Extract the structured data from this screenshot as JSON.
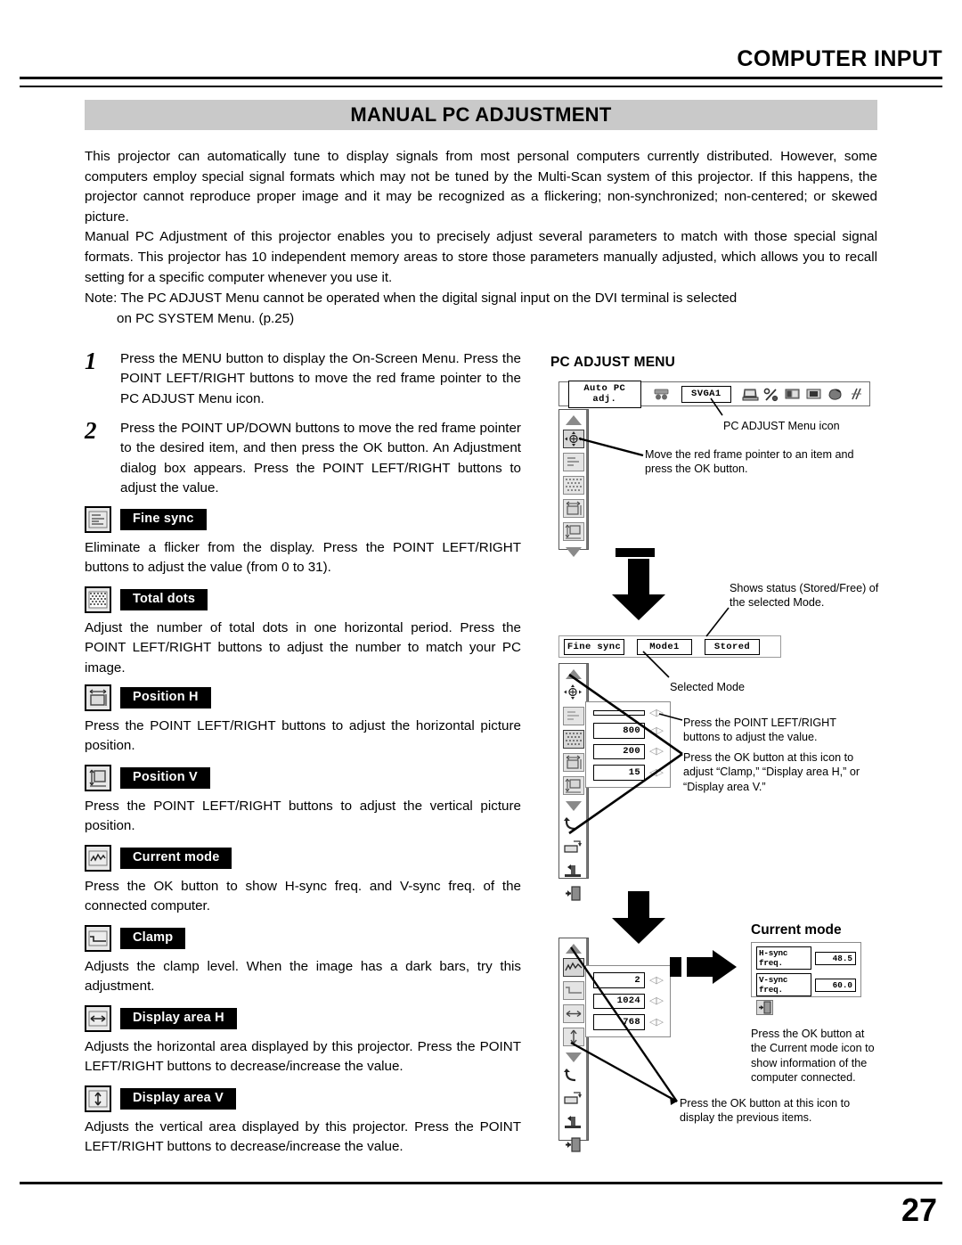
{
  "header": {
    "title": "COMPUTER INPUT",
    "section_title": "MANUAL PC ADJUSTMENT"
  },
  "intro": {
    "para1": "This projector can automatically tune to display signals from most personal computers currently distributed. However, some computers employ special signal formats which may not be tuned by the Multi-Scan system of this projector. If this happens, the projector cannot reproduce proper image and it may be recognized as a flickering; non-synchronized; non-centered; or skewed picture.",
    "para2": "Manual PC Adjustment of this projector enables you to precisely adjust several parameters to match with those special signal formats. This projector has 10 independent memory areas to store those parameters manually adjusted, which allows you to recall setting for a specific computer whenever you use it.",
    "note_line1": "Note: The PC ADJUST Menu cannot be operated when the digital signal input on the DVI terminal is selected",
    "note_line2": "on PC SYSTEM Menu. (p.25)"
  },
  "steps": [
    {
      "number": "1",
      "text": "Press the MENU button to display the On-Screen Menu. Press the POINT LEFT/RIGHT buttons to move the red frame pointer to the PC ADJUST Menu icon."
    },
    {
      "number": "2",
      "text": "Press the POINT UP/DOWN buttons to move the red frame pointer to the desired item, and then press the OK button. An Adjustment dialog box appears. Press the POINT LEFT/RIGHT buttons to adjust the value."
    }
  ],
  "items": [
    {
      "icon": "fine-sync-icon",
      "label": "Fine sync",
      "body": "Eliminate a flicker from the display. Press the POINT LEFT/RIGHT buttons to adjust the value (from 0 to 31)."
    },
    {
      "icon": "total-dots-icon",
      "label": "Total dots",
      "body": "Adjust the number of total dots in one horizontal period. Press the POINT LEFT/RIGHT buttons to adjust the number to match your PC image."
    },
    {
      "icon": "position-h-icon",
      "label": "Position H",
      "body": "Press the POINT LEFT/RIGHT buttons to adjust the horizontal picture position."
    },
    {
      "icon": "position-v-icon",
      "label": "Position V",
      "body": "Press the POINT LEFT/RIGHT buttons to adjust the vertical picture position."
    },
    {
      "icon": "current-mode-icon",
      "label": "Current mode",
      "body": "Press the OK button to show H-sync freq. and V-sync freq. of  the connected computer."
    },
    {
      "icon": "clamp-icon",
      "label": "Clamp",
      "body": "Adjusts the clamp level. When the image has a dark bars, try this adjustment."
    },
    {
      "icon": "display-area-h-icon",
      "label": "Display area H",
      "body": "Adjusts the horizontal area displayed by this projector. Press the POINT LEFT/RIGHT buttons to decrease/increase the value."
    },
    {
      "icon": "display-area-v-icon",
      "label": "Display area V",
      "body": "Adjusts the vertical area displayed by this projector. Press the POINT LEFT/RIGHT buttons to decrease/increase the value."
    }
  ],
  "panel": {
    "title": "PC ADJUST MENU",
    "menubar": {
      "auto_pc_label": "Auto PC adj.",
      "svga_label": "SVGA1"
    },
    "annotations": {
      "menu_icon": "PC ADJUST Menu icon",
      "move_pointer": "Move the red frame pointer to an item and press the OK button.",
      "status": "Shows status (Stored/Free) of the selected Mode.",
      "selected_mode": "Selected Mode",
      "adjust_value": "Press the POINT LEFT/RIGHT buttons to adjust the value.",
      "ok_clamp": "Press the OK button at this icon to adjust “Clamp,” “Display area H,” or “Display area V.”",
      "current_mode": "Press the OK button at the Current mode icon to show information of the computer connected.",
      "previous_items": "Press the OK button at this icon to display the previous items."
    },
    "modebar": {
      "item_label": "Fine sync",
      "mode_label": "Mode1",
      "status_label": "Stored"
    },
    "dialog_upper_values": [
      "",
      "800",
      "200",
      "15"
    ],
    "dialog_lower_values": [
      "2",
      "1024",
      "768"
    ],
    "current_mode": {
      "title": "Current mode",
      "hsync_label": "H-sync freq.",
      "hsync_value": "48.5",
      "vsync_label": "V-sync freq.",
      "vsync_value": "60.0"
    }
  },
  "footer": {
    "page_number": "27"
  }
}
